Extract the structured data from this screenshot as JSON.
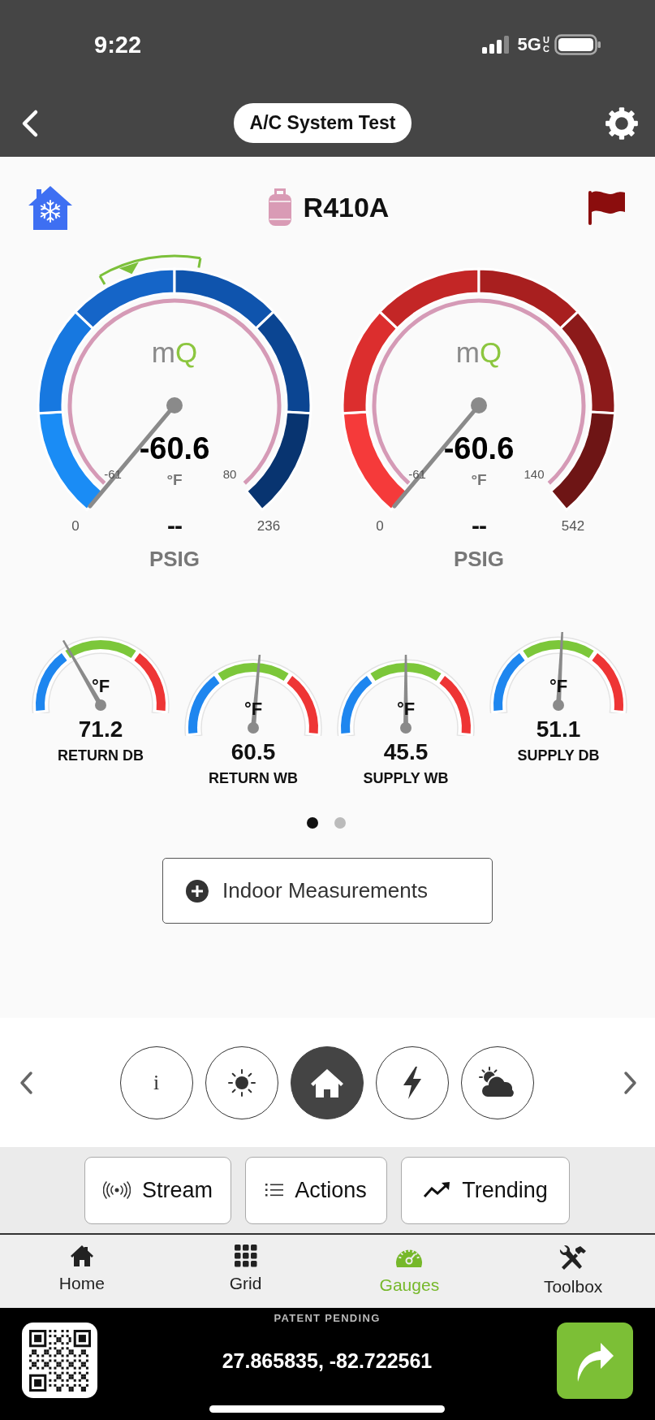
{
  "status_bar": {
    "time": "9:22",
    "network": "5G",
    "network_badge": "UC"
  },
  "header": {
    "title": "A/C System Test"
  },
  "refrigerant": {
    "name": "R410A"
  },
  "pressure_gauges": [
    {
      "kind": "low",
      "brand": "mQ",
      "temperature": "-60.6",
      "temperature_unit": "°F",
      "temp_min": "-61",
      "temp_max": "80",
      "scale_min": "0",
      "pressure": "--",
      "scale_max": "236",
      "pressure_unit": "PSIG"
    },
    {
      "kind": "high",
      "brand": "mQ",
      "temperature": "-60.6",
      "temperature_unit": "°F",
      "temp_min": "-61",
      "temp_max": "140",
      "scale_min": "0",
      "pressure": "--",
      "scale_max": "542",
      "pressure_unit": "PSIG"
    }
  ],
  "temperature_gauges": [
    {
      "unit": "°F",
      "value": "71.2",
      "label": "RETURN DB"
    },
    {
      "unit": "°F",
      "value": "60.5",
      "label": "RETURN WB"
    },
    {
      "unit": "°F",
      "value": "45.5",
      "label": "SUPPLY WB"
    },
    {
      "unit": "°F",
      "value": "51.1",
      "label": "SUPPLY DB"
    }
  ],
  "page_dots": [
    {
      "selected": true
    },
    {
      "selected": false
    }
  ],
  "indoor_button": {
    "label": "Indoor Measurements"
  },
  "mode_buttons": [
    {
      "kind": "info",
      "label": "i",
      "selected": false
    },
    {
      "kind": "sun",
      "selected": false
    },
    {
      "kind": "home",
      "selected": true
    },
    {
      "kind": "power",
      "selected": false
    },
    {
      "kind": "weather",
      "selected": false
    }
  ],
  "actions": [
    {
      "kind": "stream",
      "label": "Stream"
    },
    {
      "kind": "actions",
      "label": "Actions"
    },
    {
      "kind": "trending",
      "label": "Trending"
    }
  ],
  "tabs": [
    {
      "kind": "home",
      "label": "Home",
      "selected": false
    },
    {
      "kind": "grid",
      "label": "Grid",
      "selected": false
    },
    {
      "kind": "gauges",
      "label": "Gauges",
      "selected": true
    },
    {
      "kind": "toolbox",
      "label": "Toolbox",
      "selected": false
    }
  ],
  "footer": {
    "notice": "PATENT PENDING",
    "coordinates": "27.865835, -82.722561"
  }
}
